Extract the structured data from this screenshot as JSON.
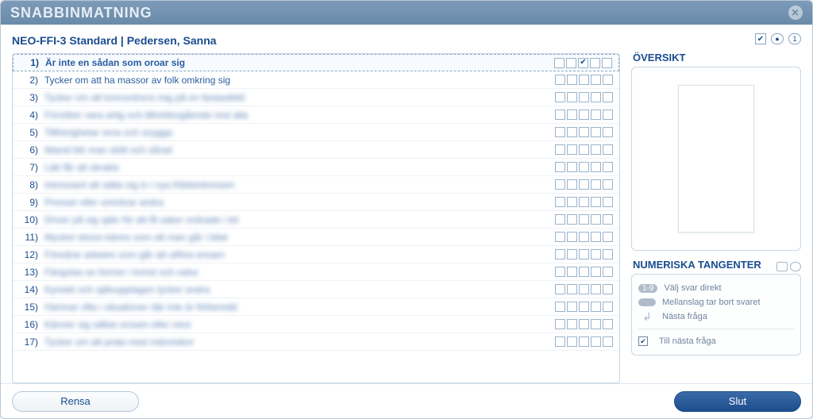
{
  "title": "SNABBINMATNING",
  "header": {
    "test_name": "NEO-FFI-3 Standard",
    "separator": " | ",
    "subject": "Pedersen, Sanna"
  },
  "questions": [
    {
      "n": "1)",
      "text": "Är inte en sådan som oroar sig",
      "active": true,
      "blurred": false,
      "selected": 2
    },
    {
      "n": "2)",
      "text": "Tycker om att ha massor av folk omkring sig",
      "active": false,
      "blurred": false,
      "selected": null
    },
    {
      "n": "3)",
      "text": "Tycker om att koncentrera mig på en fantasibild",
      "active": false,
      "blurred": true,
      "selected": null
    },
    {
      "n": "4)",
      "text": "Försöker vara artig och tillmötesgående mot alla",
      "active": false,
      "blurred": true,
      "selected": null
    },
    {
      "n": "5)",
      "text": "Tillhörighetar rena och snygga",
      "active": false,
      "blurred": true,
      "selected": null
    },
    {
      "n": "6)",
      "text": "Ibland blir man stött och sårad",
      "active": false,
      "blurred": true,
      "selected": null
    },
    {
      "n": "7)",
      "text": "Lätt får att skratta",
      "active": false,
      "blurred": true,
      "selected": null
    },
    {
      "n": "8)",
      "text": "Intressant att sätta sig in i nya fritidsintressen",
      "active": false,
      "blurred": true,
      "selected": null
    },
    {
      "n": "9)",
      "text": "Pressar eller smickrar andra",
      "active": false,
      "blurred": true,
      "selected": null
    },
    {
      "n": "10)",
      "text": "Driver på sig själv för att få saker ordnade i tid",
      "active": false,
      "blurred": true,
      "selected": null
    },
    {
      "n": "11)",
      "text": "Mycket stress känns som att man går i bitar",
      "active": false,
      "blurred": true,
      "selected": null
    },
    {
      "n": "12)",
      "text": "Föredrar arbeten som går att utföra ensam",
      "active": false,
      "blurred": true,
      "selected": null
    },
    {
      "n": "13)",
      "text": "Fängslas av former i konst och natur",
      "active": false,
      "blurred": true,
      "selected": null
    },
    {
      "n": "14)",
      "text": "Kyniskt och självupptagen tycker andra",
      "active": false,
      "blurred": true,
      "selected": null
    },
    {
      "n": "15)",
      "text": "Hamnar ofta i situationer där inte är förberedd",
      "active": false,
      "blurred": true,
      "selected": null
    },
    {
      "n": "16)",
      "text": "Känner sig sällan ensam eller nere",
      "active": false,
      "blurred": true,
      "selected": null
    },
    {
      "n": "17)",
      "text": "Tycker om att prata med människor",
      "active": false,
      "blurred": true,
      "selected": null
    }
  ],
  "option_count": 5,
  "overview": {
    "title": "ÖVERSIKT"
  },
  "numkeys": {
    "title": "NUMERISKA TANGENTER",
    "badge": "1-9",
    "line1": "Välj svar direkt",
    "line2": "Mellanslag tar bort svaret",
    "line3": "Nästa fråga",
    "checkbox_label": "Till nästa fråga",
    "checkbox_checked": true
  },
  "footer": {
    "clear": "Rensa",
    "close": "Slut"
  }
}
